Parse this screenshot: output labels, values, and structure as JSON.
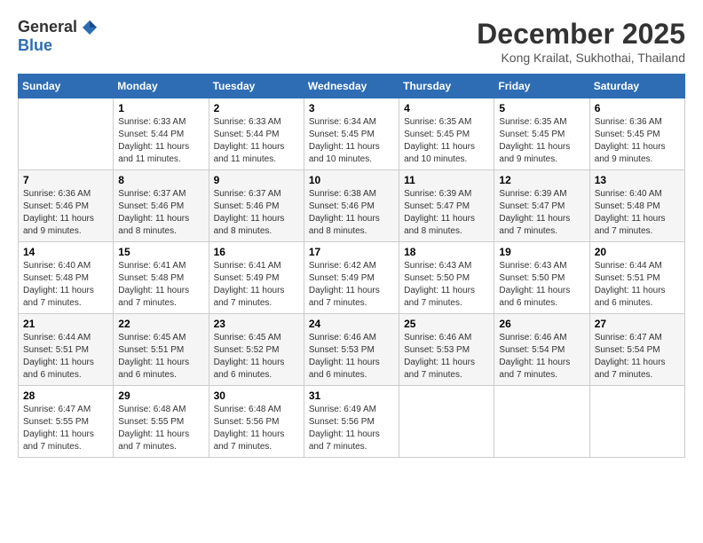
{
  "logo": {
    "general": "General",
    "blue": "Blue"
  },
  "title": "December 2025",
  "location": "Kong Krailat, Sukhothai, Thailand",
  "days_of_week": [
    "Sunday",
    "Monday",
    "Tuesday",
    "Wednesday",
    "Thursday",
    "Friday",
    "Saturday"
  ],
  "weeks": [
    [
      {
        "day": "",
        "info": ""
      },
      {
        "day": "1",
        "info": "Sunrise: 6:33 AM\nSunset: 5:44 PM\nDaylight: 11 hours and 11 minutes."
      },
      {
        "day": "2",
        "info": "Sunrise: 6:33 AM\nSunset: 5:44 PM\nDaylight: 11 hours and 11 minutes."
      },
      {
        "day": "3",
        "info": "Sunrise: 6:34 AM\nSunset: 5:45 PM\nDaylight: 11 hours and 10 minutes."
      },
      {
        "day": "4",
        "info": "Sunrise: 6:35 AM\nSunset: 5:45 PM\nDaylight: 11 hours and 10 minutes."
      },
      {
        "day": "5",
        "info": "Sunrise: 6:35 AM\nSunset: 5:45 PM\nDaylight: 11 hours and 9 minutes."
      },
      {
        "day": "6",
        "info": "Sunrise: 6:36 AM\nSunset: 5:45 PM\nDaylight: 11 hours and 9 minutes."
      }
    ],
    [
      {
        "day": "7",
        "info": "Sunrise: 6:36 AM\nSunset: 5:46 PM\nDaylight: 11 hours and 9 minutes."
      },
      {
        "day": "8",
        "info": "Sunrise: 6:37 AM\nSunset: 5:46 PM\nDaylight: 11 hours and 8 minutes."
      },
      {
        "day": "9",
        "info": "Sunrise: 6:37 AM\nSunset: 5:46 PM\nDaylight: 11 hours and 8 minutes."
      },
      {
        "day": "10",
        "info": "Sunrise: 6:38 AM\nSunset: 5:46 PM\nDaylight: 11 hours and 8 minutes."
      },
      {
        "day": "11",
        "info": "Sunrise: 6:39 AM\nSunset: 5:47 PM\nDaylight: 11 hours and 8 minutes."
      },
      {
        "day": "12",
        "info": "Sunrise: 6:39 AM\nSunset: 5:47 PM\nDaylight: 11 hours and 7 minutes."
      },
      {
        "day": "13",
        "info": "Sunrise: 6:40 AM\nSunset: 5:48 PM\nDaylight: 11 hours and 7 minutes."
      }
    ],
    [
      {
        "day": "14",
        "info": "Sunrise: 6:40 AM\nSunset: 5:48 PM\nDaylight: 11 hours and 7 minutes."
      },
      {
        "day": "15",
        "info": "Sunrise: 6:41 AM\nSunset: 5:48 PM\nDaylight: 11 hours and 7 minutes."
      },
      {
        "day": "16",
        "info": "Sunrise: 6:41 AM\nSunset: 5:49 PM\nDaylight: 11 hours and 7 minutes."
      },
      {
        "day": "17",
        "info": "Sunrise: 6:42 AM\nSunset: 5:49 PM\nDaylight: 11 hours and 7 minutes."
      },
      {
        "day": "18",
        "info": "Sunrise: 6:43 AM\nSunset: 5:50 PM\nDaylight: 11 hours and 7 minutes."
      },
      {
        "day": "19",
        "info": "Sunrise: 6:43 AM\nSunset: 5:50 PM\nDaylight: 11 hours and 6 minutes."
      },
      {
        "day": "20",
        "info": "Sunrise: 6:44 AM\nSunset: 5:51 PM\nDaylight: 11 hours and 6 minutes."
      }
    ],
    [
      {
        "day": "21",
        "info": "Sunrise: 6:44 AM\nSunset: 5:51 PM\nDaylight: 11 hours and 6 minutes."
      },
      {
        "day": "22",
        "info": "Sunrise: 6:45 AM\nSunset: 5:51 PM\nDaylight: 11 hours and 6 minutes."
      },
      {
        "day": "23",
        "info": "Sunrise: 6:45 AM\nSunset: 5:52 PM\nDaylight: 11 hours and 6 minutes."
      },
      {
        "day": "24",
        "info": "Sunrise: 6:46 AM\nSunset: 5:53 PM\nDaylight: 11 hours and 6 minutes."
      },
      {
        "day": "25",
        "info": "Sunrise: 6:46 AM\nSunset: 5:53 PM\nDaylight: 11 hours and 7 minutes."
      },
      {
        "day": "26",
        "info": "Sunrise: 6:46 AM\nSunset: 5:54 PM\nDaylight: 11 hours and 7 minutes."
      },
      {
        "day": "27",
        "info": "Sunrise: 6:47 AM\nSunset: 5:54 PM\nDaylight: 11 hours and 7 minutes."
      }
    ],
    [
      {
        "day": "28",
        "info": "Sunrise: 6:47 AM\nSunset: 5:55 PM\nDaylight: 11 hours and 7 minutes."
      },
      {
        "day": "29",
        "info": "Sunrise: 6:48 AM\nSunset: 5:55 PM\nDaylight: 11 hours and 7 minutes."
      },
      {
        "day": "30",
        "info": "Sunrise: 6:48 AM\nSunset: 5:56 PM\nDaylight: 11 hours and 7 minutes."
      },
      {
        "day": "31",
        "info": "Sunrise: 6:49 AM\nSunset: 5:56 PM\nDaylight: 11 hours and 7 minutes."
      },
      {
        "day": "",
        "info": ""
      },
      {
        "day": "",
        "info": ""
      },
      {
        "day": "",
        "info": ""
      }
    ]
  ]
}
